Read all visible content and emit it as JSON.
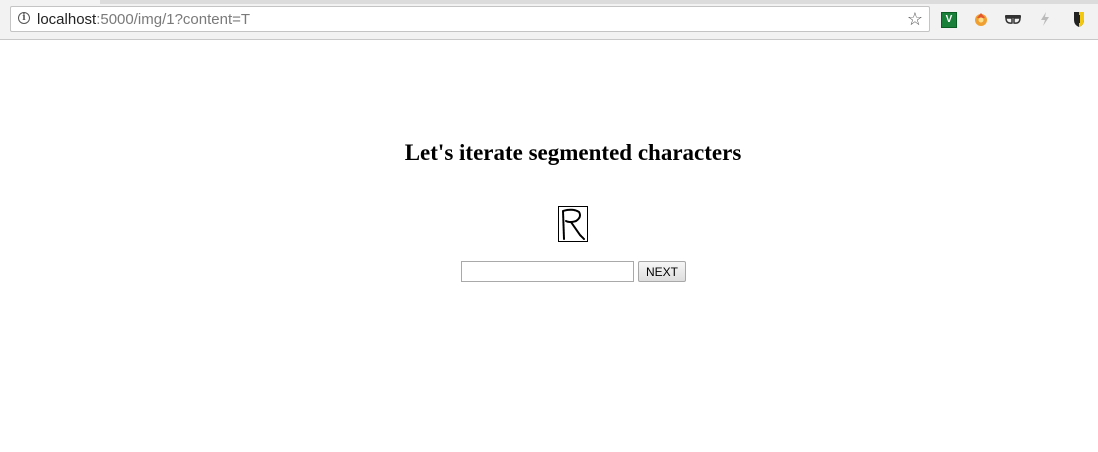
{
  "browser": {
    "url_host": "localhost",
    "url_rest": ":5000/img/1?content=T",
    "extension_v_label": "V",
    "extensions": [
      "v-extension-icon",
      "fire-extension-icon",
      "glasses-extension-icon",
      "bolt-extension-icon",
      "shield-extension-icon"
    ]
  },
  "page": {
    "heading": "Let's iterate segmented characters",
    "image_content": "R",
    "input_value": "",
    "next_label": "NEXT"
  }
}
